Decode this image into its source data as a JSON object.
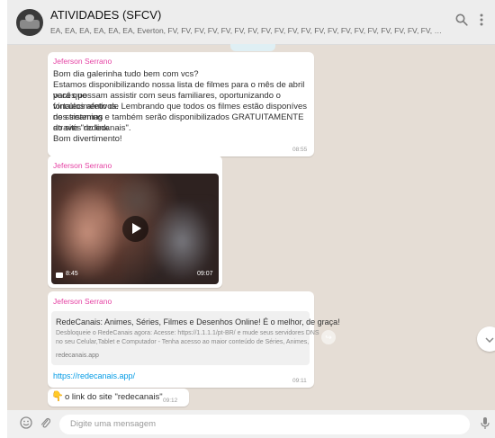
{
  "header": {
    "title": "ATIVIDADES (SFCV)",
    "participants": "EA, EA, EA, EA, EA, EA, Everton, FV, FV, FV, FV, FV, FV, FV, FV, FV, FV, FV, FV, FV, FV, FV, FV, FV, FV, FV, FV, FV, FV, FV, FV, FV, FV, FV, FV, FV, FV, FV, FV, FV, ...",
    "search_icon": "search-icon",
    "menu_icon": "menu-dots-icon"
  },
  "messages": [
    {
      "sender": "Jeferson Serrano",
      "lines": [
        "Bom dia galerinha tudo bem com vcs?",
        "Estamos disponibilizando nossa lista de filmes para o mês de abril para que",
        "vocês possam assistir com seus familiares, oportunizando o fortalecimento de",
        "vínculos afetivos. Lembrando que todos os filmes estão disponíves nos sistemas",
        "de streaming e também serão disponibilizados GRATUITAMENTE através do link",
        "do site \"redecanais\".",
        "Bom divertimento!"
      ],
      "time": "08:55"
    },
    {
      "sender": "Jeferson Serrano",
      "video_duration": "8:45",
      "time": "09:07"
    },
    {
      "sender": "Jeferson Serrano",
      "preview_title": "RedeCanais: Animes, Séries, Filmes e Desenhos Online! É o melhor, de graça!",
      "preview_desc_1": "Desbloqueie o RedeCanais agora: Acesse: https://1.1.1.1/pt-BR/ e mude seus servidores DNS",
      "preview_desc_2": "no seu Celular,Tablet e Computador - Tenha acesso ao maior conteúdo de Séries, Animes,",
      "preview_domain": "redecanais.app",
      "link": "https://redecanais.app/",
      "time": "09:11"
    },
    {
      "emoji": "👇",
      "text": "o link do site \"redecanais\"",
      "time": "09:12"
    }
  ],
  "footer": {
    "placeholder": "Digite uma mensagem",
    "emoji_icon": "emoji-icon",
    "attach_icon": "attach-icon",
    "mic_icon": "mic-icon"
  },
  "colors": {
    "chat_background": "#e5ddd5",
    "sender_name": "#e542a3",
    "link": "#039be5",
    "header_background": "#ededed"
  }
}
